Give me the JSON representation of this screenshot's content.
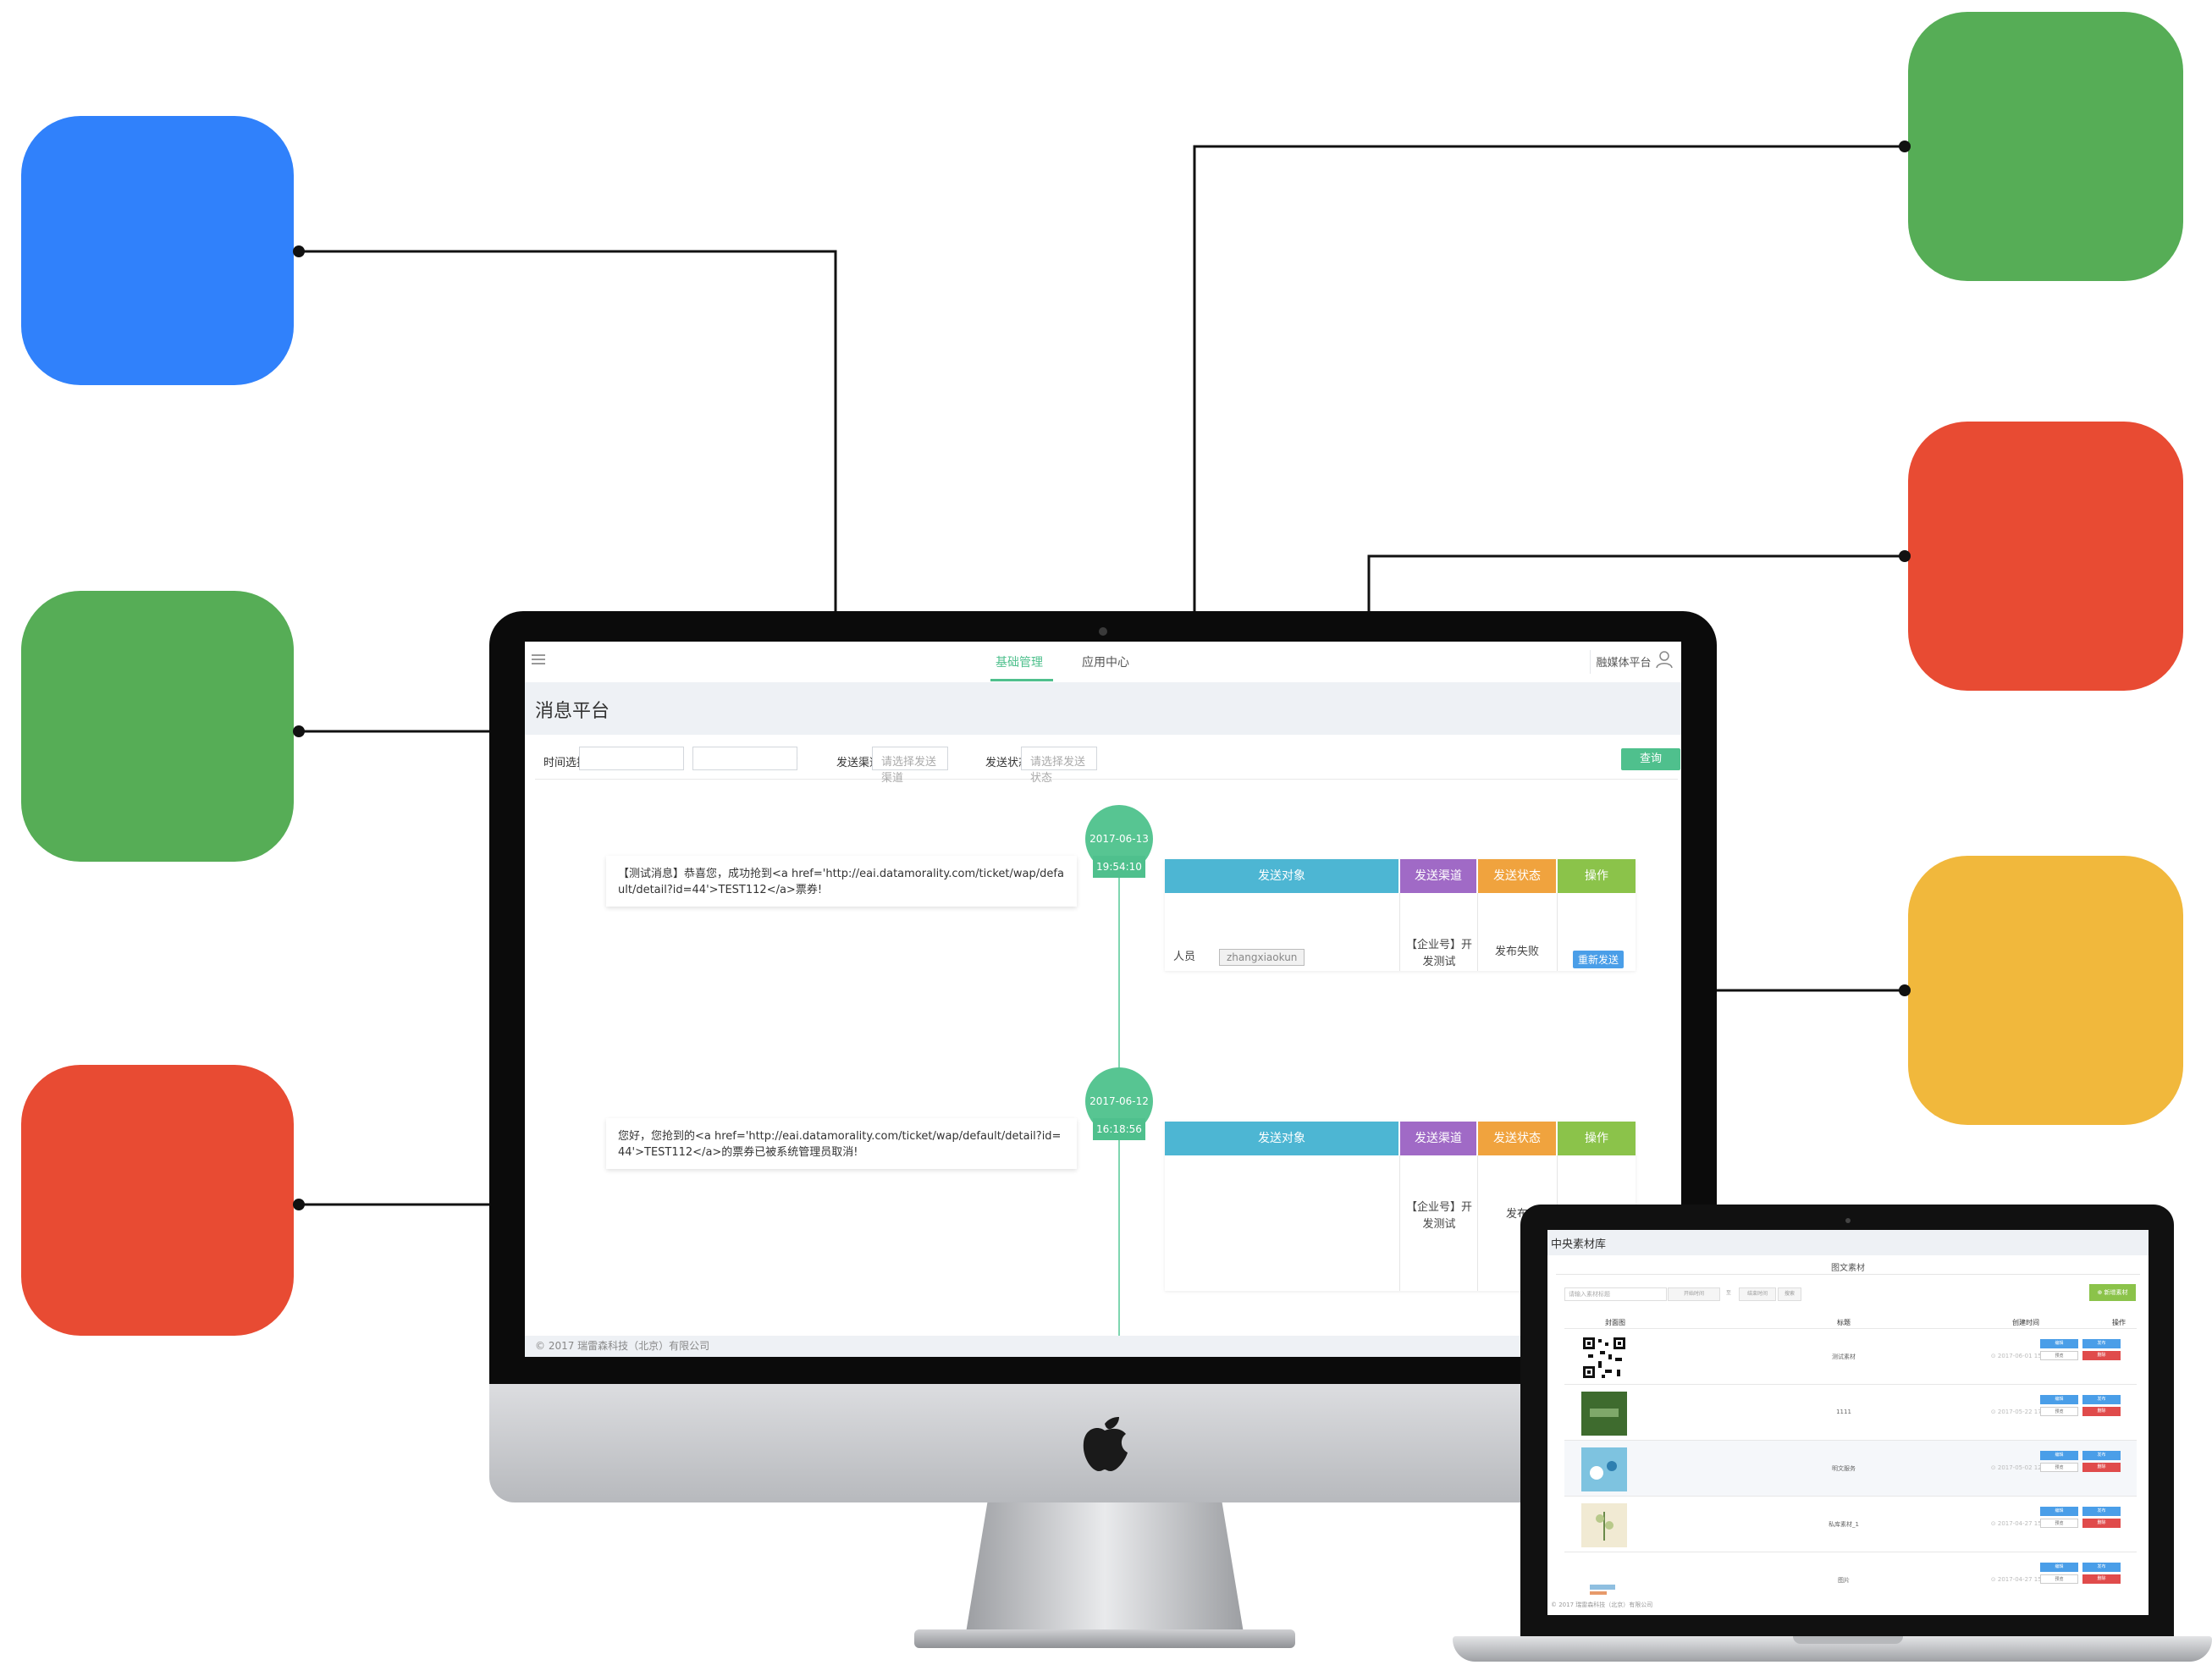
{
  "colors": {
    "tile_blue": "#3081fb",
    "tile_green": "#56ad56",
    "tile_red": "#e84b33",
    "tile_yellow": "#f1b83c",
    "accent_green": "#4fc08d",
    "header_target": "#4db6d3",
    "header_channel": "#a06ac6",
    "header_status": "#f0a33e",
    "header_op": "#8bc34a"
  },
  "desktop": {
    "nav": {
      "active_tab": "基础管理",
      "other_tab": "应用中心",
      "platform": "融媒体平台"
    },
    "page_title": "消息平台",
    "filter": {
      "time_label": "时间选择:",
      "dash": "-",
      "channel_label": "发送渠道:",
      "channel_placeholder": "请选择发送渠道",
      "status_label": "发送状态:",
      "status_placeholder": "请选择发送状态",
      "query_button": "查询"
    },
    "table_headers": {
      "target": "发送对象",
      "channel": "发送渠道",
      "status": "发送状态",
      "op": "操作"
    },
    "entries": [
      {
        "date": "2017-06-13",
        "time": "19:54:10",
        "message": "【测试消息】恭喜您，成功抢到<a href='http://eai.datamorality.com/ticket/wap/default/detail?id=44'>TEST112</a>票券!",
        "target_type": "人员",
        "target_user": "zhangxiaokun",
        "channel": "【企业号】开发测试",
        "status": "发布失败",
        "action": "重新发送"
      },
      {
        "date": "2017-06-12",
        "time": "16:18:56",
        "message": "您好，您抢到的<a href='http://eai.datamorality.com/ticket/wap/default/detail?id=44'>TEST112</a>的票券已被系统管理员取消!",
        "channel": "【企业号】开发测试",
        "status": "发布"
      }
    ],
    "footer": "© 2017 瑞雷森科技（北京）有限公司"
  },
  "laptop": {
    "title": "中央素材库",
    "subtitle": "图文素材",
    "search_placeholder": "请输入素材标题",
    "date_start": "开始时间",
    "date_to": "至",
    "date_end": "结束时间",
    "search_button": "搜索",
    "add_button": "⊕ 新增素材",
    "columns": [
      "封面图",
      "标题",
      "创建时间",
      "操作"
    ],
    "rows": [
      {
        "title": "测试素材",
        "time": "⊙ 2017-06-01 15:41:52"
      },
      {
        "title": "1111",
        "time": "⊙ 2017-05-22 17:03:53"
      },
      {
        "title": "明文服务",
        "time": "⊙ 2017-05-02 12:32:21"
      },
      {
        "title": "私库素材_1",
        "time": "⊙ 2017-04-27 15:29:56"
      },
      {
        "title": "图片",
        "time": "⊙ 2017-04-27 15:32:43"
      }
    ],
    "row_buttons": {
      "edit": "编辑",
      "publish": "发布",
      "preview": "预览",
      "delete": "删除"
    },
    "footer": "© 2017 瑞雷森科技（北京）有限公司"
  }
}
